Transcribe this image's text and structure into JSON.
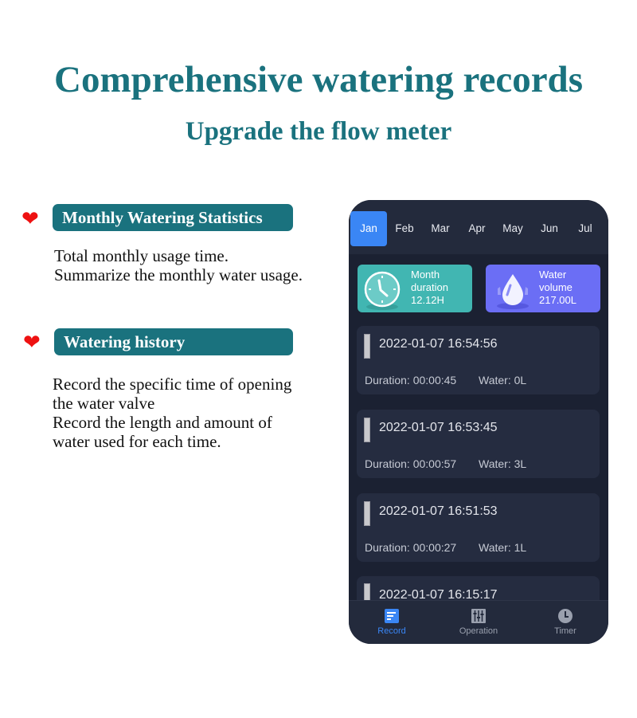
{
  "header": {
    "title": "Comprehensive watering records",
    "subtitle": "Upgrade the flow meter"
  },
  "features": [
    {
      "icon": "heart-icon",
      "heading": "Monthly Watering Statistics",
      "lines": [
        "Total monthly usage time.",
        "Summarize the monthly water usage."
      ]
    },
    {
      "icon": "heart-icon",
      "heading": "Watering history",
      "lines": [
        "Record the specific time of opening",
        "the water valve",
        "Record the length and amount of",
        "water used for each time."
      ]
    }
  ],
  "app": {
    "months": [
      "Jan",
      "Feb",
      "Mar",
      "Apr",
      "May",
      "Jun",
      "Jul"
    ],
    "selected_month": "Jan",
    "stats": {
      "duration": {
        "label1": "Month",
        "label2": "duration",
        "value": "12.12H",
        "icon": "clock-icon",
        "color": "#41b6b2"
      },
      "volume": {
        "label1": "Water",
        "label2": "volume",
        "value": "217.00L",
        "icon": "water-drop-icon",
        "color": "#6b6ef5"
      }
    },
    "records": [
      {
        "timestamp": "2022-01-07 16:54:56",
        "duration": "Duration: 00:00:45",
        "water": "Water: 0L"
      },
      {
        "timestamp": "2022-01-07 16:53:45",
        "duration": "Duration: 00:00:57",
        "water": "Water: 3L"
      },
      {
        "timestamp": "2022-01-07 16:51:53",
        "duration": "Duration: 00:00:27",
        "water": "Water: 1L"
      },
      {
        "timestamp": "2022-01-07 16:15:17",
        "duration": "",
        "water": ""
      }
    ],
    "tabs": [
      {
        "label": "Record",
        "icon": "record-list-icon",
        "active": true
      },
      {
        "label": "Operation",
        "icon": "sliders-icon",
        "active": false
      },
      {
        "label": "Timer",
        "icon": "clock-icon",
        "active": false
      }
    ],
    "accent_color": "#3a86f5"
  }
}
